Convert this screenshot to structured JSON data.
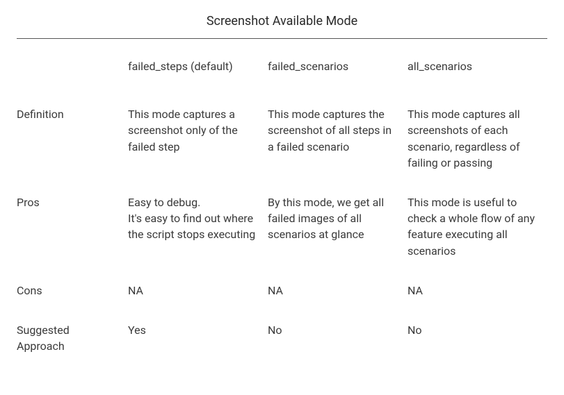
{
  "title": "Screenshot Available Mode",
  "columns": [
    {
      "label": "failed_steps (default)"
    },
    {
      "label": "failed_scenarios"
    },
    {
      "label": "all_scenarios"
    }
  ],
  "rows": {
    "definition": {
      "label": "Definition",
      "cells": [
        "This mode captures a screenshot only of the failed step",
        "This mode captures the screenshot of all steps in a failed scenario",
        "This mode captures all screenshots of each scenario, regardless of failing or passing"
      ]
    },
    "pros": {
      "label": "Pros",
      "cells_col0_line1": "Easy to debug.",
      "cells_col0_line2": "It's easy to find out where the script stops executing",
      "cells": [
        "",
        "By this mode, we get all failed images of all scenarios at glance",
        "This mode is useful to check a whole flow of any feature executing all scenarios"
      ]
    },
    "cons": {
      "label": "Cons",
      "cells": [
        "NA",
        "NA",
        "NA"
      ]
    },
    "suggested": {
      "label": "Suggested Approach",
      "cells": [
        "Yes",
        "No",
        "No"
      ]
    }
  }
}
